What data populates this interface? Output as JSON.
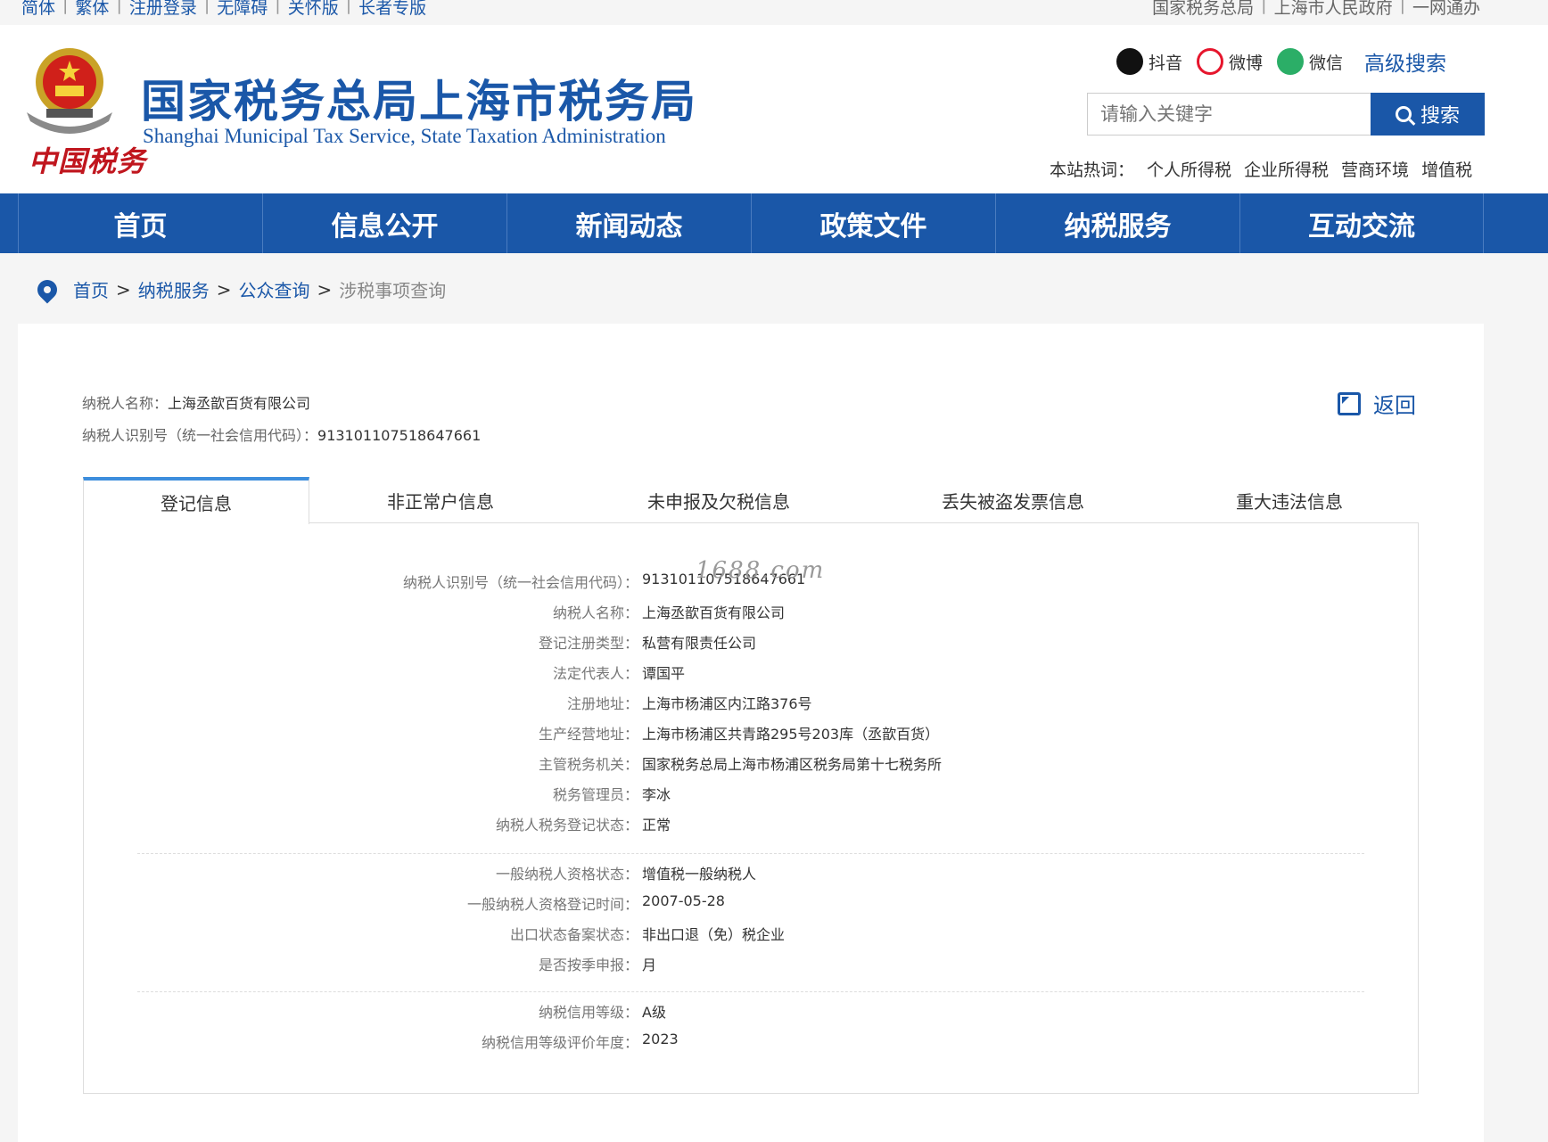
{
  "topbar": {
    "left": [
      "简体",
      "繁体",
      "注册登录",
      "无障碍",
      "关怀版",
      "长者专版"
    ],
    "right": [
      "国家税务总局",
      "上海市人民政府",
      "一网通办"
    ]
  },
  "header": {
    "emblem_text": "中国税务",
    "title": "国家税务总局上海市税务局",
    "subtitle": "Shanghai Municipal Tax Service, State Taxation Administration",
    "social": {
      "douyin": "抖音",
      "weibo": "微博",
      "wechat": "微信",
      "advanced_search": "高级搜索"
    },
    "search": {
      "placeholder": "请输入关键字",
      "button": "搜索"
    },
    "hot": {
      "label": "本站热词：",
      "terms": [
        "个人所得税",
        "企业所得税",
        "营商环境",
        "增值税"
      ]
    }
  },
  "nav": [
    "首页",
    "信息公开",
    "新闻动态",
    "政策文件",
    "纳税服务",
    "互动交流"
  ],
  "breadcrumb": {
    "items": [
      "首页",
      "纳税服务",
      "公众查询"
    ],
    "current": "涉税事项查询",
    "sep": ">"
  },
  "taxpayer": {
    "name_label": "纳税人名称：",
    "name": "上海丞歆百货有限公司",
    "id_label": "纳税人识别号（统一社会信用代码）：",
    "id": "913101107518647661",
    "back": "返回"
  },
  "tabs": [
    "登记信息",
    "非正常户信息",
    "未申报及欠税信息",
    "丢失被盗发票信息",
    "重大违法信息"
  ],
  "details": {
    "group1": [
      {
        "k": "纳税人识别号（统一社会信用代码）：",
        "v": "913101107518647661"
      },
      {
        "k": "纳税人名称：",
        "v": "上海丞歆百货有限公司"
      },
      {
        "k": "登记注册类型：",
        "v": "私营有限责任公司"
      },
      {
        "k": "法定代表人：",
        "v": "谭国平"
      },
      {
        "k": "注册地址：",
        "v": "上海市杨浦区内江路376号"
      },
      {
        "k": "生产经营地址：",
        "v": "上海市杨浦区共青路295号203库（丞歆百货）"
      },
      {
        "k": "主管税务机关：",
        "v": "国家税务总局上海市杨浦区税务局第十七税务所"
      },
      {
        "k": "税务管理员：",
        "v": "李冰"
      },
      {
        "k": "纳税人税务登记状态：",
        "v": "正常"
      }
    ],
    "group2": [
      {
        "k": "一般纳税人资格状态：",
        "v": "增值税一般纳税人"
      },
      {
        "k": "一般纳税人资格登记时间：",
        "v": "2007-05-28"
      },
      {
        "k": "出口状态备案状态：",
        "v": "非出口退（免）税企业"
      },
      {
        "k": "是否按季申报：",
        "v": "月"
      }
    ],
    "group3": [
      {
        "k": "纳税信用等级：",
        "v": "A级"
      },
      {
        "k": "纳税信用等级评价年度：",
        "v": "2023"
      }
    ]
  },
  "watermark": "1688.com"
}
